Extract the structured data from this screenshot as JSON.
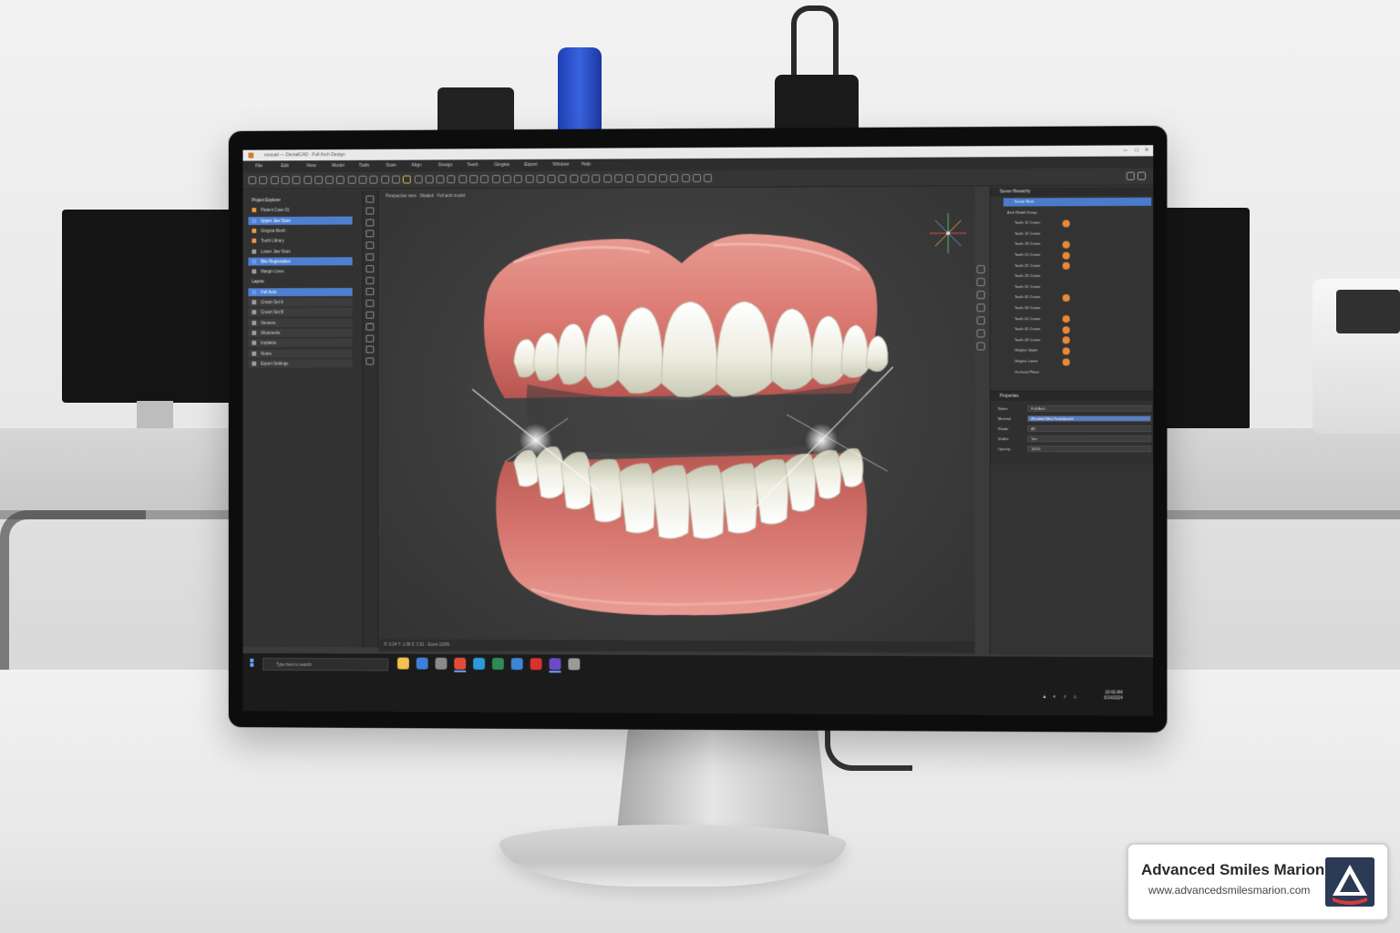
{
  "app": {
    "title": "exocad — DentalCAD  ·  Full Arch Design",
    "menu": [
      "File",
      "Edit",
      "View",
      "Model",
      "Tools",
      "Scan",
      "Align",
      "Design",
      "Teeth",
      "Gingiva",
      "Export",
      "Window",
      "Help"
    ],
    "window_controls": [
      "minimize",
      "maximize",
      "close"
    ]
  },
  "left_panel": {
    "rows": [
      {
        "label": "Project Explorer",
        "state": "header"
      },
      {
        "label": "Patient Case 01",
        "state": "normal",
        "icon": "orange"
      },
      {
        "label": "Upper Jaw Scan",
        "state": "selected",
        "icon": "blue"
      },
      {
        "label": "Gingiva Mesh",
        "state": "normal",
        "icon": "orange"
      },
      {
        "label": "Tooth Library",
        "state": "normal",
        "icon": "orange"
      },
      {
        "label": "Lower Jaw Scan",
        "state": "normal",
        "icon": "grey"
      },
      {
        "label": "Bite Registration",
        "state": "selected",
        "icon": "blue"
      },
      {
        "label": "Margin Lines",
        "state": "normal",
        "icon": "grey"
      },
      {
        "label": "Layers",
        "state": "header"
      },
      {
        "label": "Full Arch",
        "state": "selected",
        "icon": "blue"
      },
      {
        "label": "Crown Set A",
        "state": "dim",
        "icon": "grey"
      },
      {
        "label": "Crown Set B",
        "state": "dim",
        "icon": "grey"
      },
      {
        "label": "Veneers",
        "state": "dim",
        "icon": "grey"
      },
      {
        "label": "Abutments",
        "state": "dim",
        "icon": "grey"
      },
      {
        "label": "Implants",
        "state": "dim",
        "icon": "grey"
      },
      {
        "label": "Notes",
        "state": "dim",
        "icon": "grey"
      },
      {
        "label": "Export Settings",
        "state": "dim",
        "icon": "grey"
      }
    ]
  },
  "viewport": {
    "header": "Perspective view · Shaded · Full arch model",
    "footer": "X: 0.24  Y: 1.08  Z: 3.51  ·  Zoom 100%"
  },
  "right_panel": {
    "title": "Scene Hierarchy",
    "rows": [
      {
        "label": "Scene Root",
        "state": "selected",
        "dot": false
      },
      {
        "label": "Arch Model Group",
        "state": "header",
        "dot": false
      },
      {
        "label": "Tooth 11 Crown",
        "state": "normal",
        "dot": true
      },
      {
        "label": "Tooth 12 Crown",
        "state": "normal",
        "dot": false
      },
      {
        "label": "Tooth 13 Crown",
        "state": "normal",
        "dot": true
      },
      {
        "label": "Tooth 21 Crown",
        "state": "normal",
        "dot": true
      },
      {
        "label": "Tooth 22 Crown",
        "state": "normal",
        "dot": true
      },
      {
        "label": "Tooth 23 Crown",
        "state": "normal",
        "dot": false
      },
      {
        "label": "Tooth 31 Crown",
        "state": "normal",
        "dot": false
      },
      {
        "label": "Tooth 32 Crown",
        "state": "normal",
        "dot": true
      },
      {
        "label": "Tooth 33 Crown",
        "state": "normal",
        "dot": false
      },
      {
        "label": "Tooth 41 Crown",
        "state": "normal",
        "dot": true
      },
      {
        "label": "Tooth 42 Crown",
        "state": "normal",
        "dot": true
      },
      {
        "label": "Tooth 43 Crown",
        "state": "normal",
        "dot": true
      },
      {
        "label": "Gingiva Upper",
        "state": "normal",
        "dot": true
      },
      {
        "label": "Gingiva Lower",
        "state": "normal",
        "dot": true
      },
      {
        "label": "Occlusal Plane",
        "state": "normal",
        "dot": false
      }
    ],
    "properties": {
      "title": "Properties",
      "rows": [
        {
          "key": "Name",
          "value": "Full Arch",
          "selected": false
        },
        {
          "key": "Material",
          "value": "Zirconia Ultra Translucent",
          "selected": true
        },
        {
          "key": "Shade",
          "value": "A1",
          "selected": false
        },
        {
          "key": "Visible",
          "value": "Yes",
          "selected": false
        },
        {
          "key": "Opacity",
          "value": "100%",
          "selected": false
        }
      ]
    }
  },
  "taskbar": {
    "search_placeholder": "Type here to search",
    "time": "10:42 AM",
    "date": "6/14/2024",
    "apps": [
      {
        "name": "file-explorer-icon",
        "color": "#f2c14e"
      },
      {
        "name": "search-app-icon",
        "color": "#3f7fd9"
      },
      {
        "name": "photos-icon",
        "color": "#8a8a8a"
      },
      {
        "name": "chrome-icon",
        "color": "#e24b3b"
      },
      {
        "name": "edge-icon",
        "color": "#2a9bd8"
      },
      {
        "name": "excel-icon",
        "color": "#2e8b57"
      },
      {
        "name": "ie-icon",
        "color": "#3d86d6"
      },
      {
        "name": "opera-icon",
        "color": "#d8312f"
      },
      {
        "name": "visual-studio-icon",
        "color": "#6a4bc4"
      },
      {
        "name": "settings-icon",
        "color": "#9a9a9a"
      }
    ]
  },
  "watermark": {
    "title": "Advanced Smiles Marion",
    "url": "www.advancedsmilesmarion.com"
  }
}
